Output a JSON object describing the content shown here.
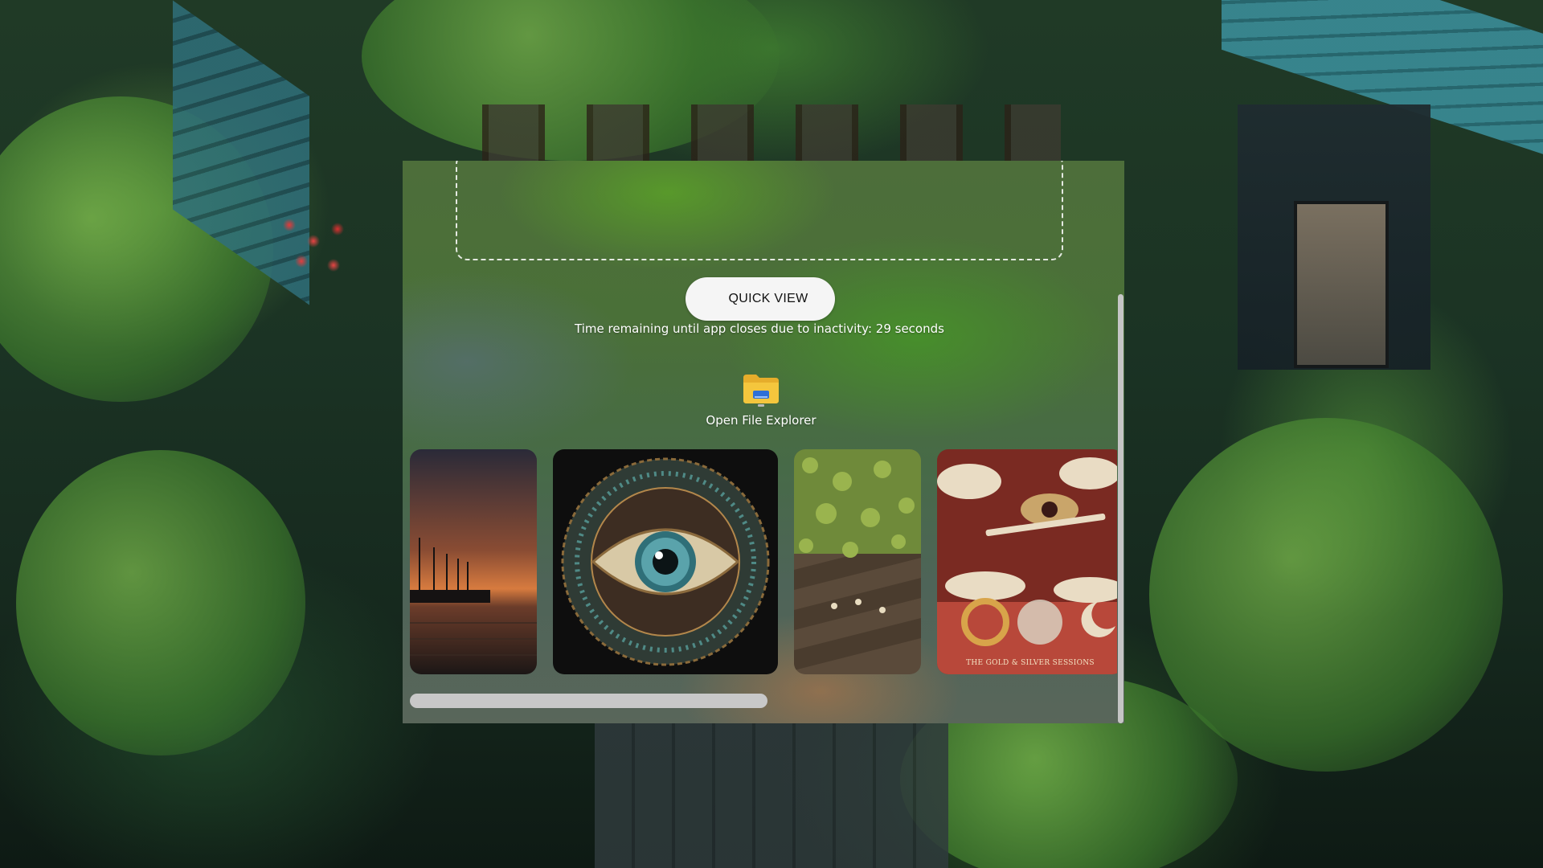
{
  "dropzone": {
    "hint": ""
  },
  "quick_view": {
    "label": "QUICK VIEW"
  },
  "timer": {
    "text": "Time remaining until app closes due to inactivity: 29 seconds",
    "seconds": 29
  },
  "file_explorer": {
    "label": "Open File Explorer",
    "icon": "folder-icon"
  },
  "gallery": {
    "thumbnails": [
      {
        "subject": "pier-at-sunset",
        "icon": "image"
      },
      {
        "subject": "ornamental-eye-mandala",
        "icon": "image"
      },
      {
        "subject": "vines-on-wooden-boards",
        "icon": "image"
      },
      {
        "subject": "album-cover",
        "caption": "THE GOLD & SILVER SESSIONS"
      }
    ]
  },
  "scrollbars": {
    "horizontal_position": 0.0,
    "vertical_position": 0.25
  },
  "colors": {
    "button_bg": "#f5f5f5",
    "scroll_thumb": "#c8c8c8",
    "folder_yellow": "#f4c63d",
    "folder_blue": "#2f6fd6"
  }
}
